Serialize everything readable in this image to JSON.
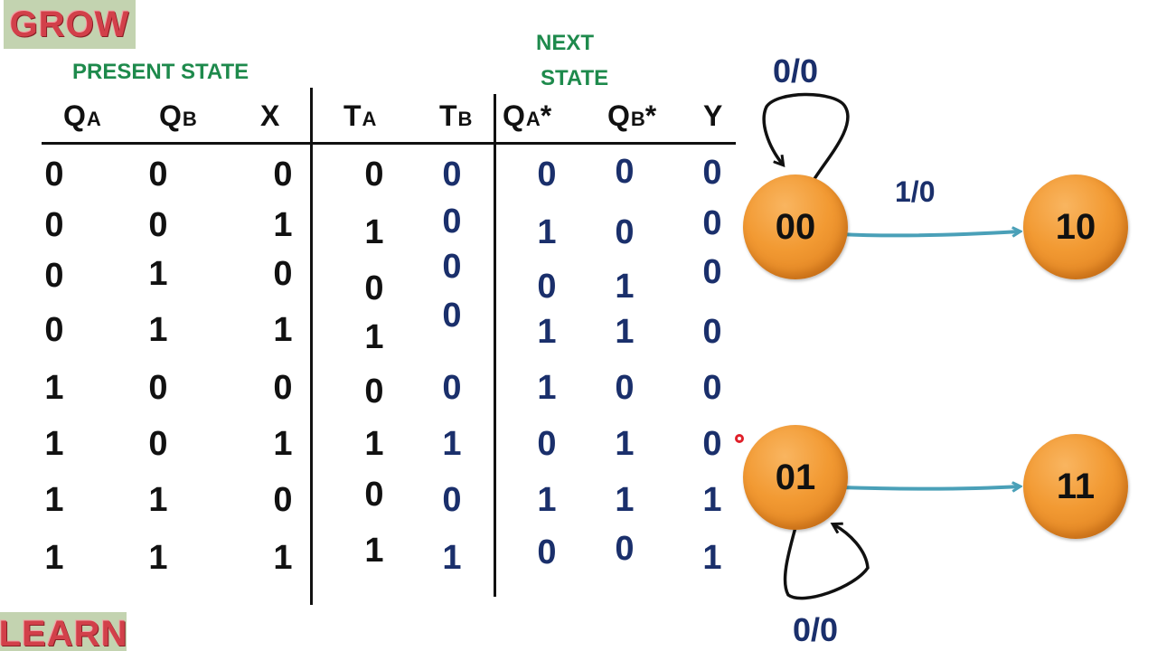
{
  "badges": {
    "top": "GROW",
    "bottom": "LEARN"
  },
  "group_labels": {
    "present_state": "PRESENT STATE",
    "next_state_line1": "NEXT",
    "next_state_line2": "STATE"
  },
  "table": {
    "headers": [
      {
        "main": "Q",
        "sub": "A",
        "suffix": ""
      },
      {
        "main": "Q",
        "sub": "B",
        "suffix": ""
      },
      {
        "main": "X",
        "sub": "",
        "suffix": ""
      },
      {
        "main": "T",
        "sub": "A",
        "suffix": ""
      },
      {
        "main": "T",
        "sub": "B",
        "suffix": ""
      },
      {
        "main": "Q",
        "sub": "A",
        "suffix": "*"
      },
      {
        "main": "Q",
        "sub": "B",
        "suffix": "*"
      },
      {
        "main": "Y",
        "sub": "",
        "suffix": ""
      }
    ],
    "rows": [
      [
        "0",
        "0",
        "0",
        "0",
        "0",
        "0",
        "0",
        "0"
      ],
      [
        "0",
        "0",
        "1",
        "1",
        "0",
        "1",
        "0",
        "0"
      ],
      [
        "0",
        "1",
        "0",
        "0",
        "0",
        "0",
        "1",
        "0"
      ],
      [
        "0",
        "1",
        "1",
        "1",
        "0",
        "1",
        "1",
        "0"
      ],
      [
        "1",
        "0",
        "0",
        "0",
        "0",
        "1",
        "0",
        "0"
      ],
      [
        "1",
        "0",
        "1",
        "1",
        "1",
        "0",
        "1",
        "0"
      ],
      [
        "1",
        "1",
        "0",
        "0",
        "0",
        "1",
        "1",
        "1"
      ],
      [
        "1",
        "1",
        "1",
        "1",
        "1",
        "0",
        "0",
        "1"
      ]
    ]
  },
  "diagram": {
    "states": [
      "00",
      "10",
      "01",
      "11"
    ],
    "transitions": [
      {
        "from": "00",
        "to": "00",
        "label": "0/0"
      },
      {
        "from": "00",
        "to": "10",
        "label": "1/0"
      },
      {
        "from": "01",
        "to": "11",
        "label": ""
      },
      {
        "from": "01",
        "to": "01",
        "label": "0/0"
      }
    ]
  },
  "colors": {
    "node_fill": "#f29a33",
    "arrow": "#4aa0b8",
    "label_blue": "#1a2f6b",
    "heading_green": "#1e8a4c",
    "badge_text": "#d2404a",
    "badge_bg": "#c3d3b0"
  }
}
